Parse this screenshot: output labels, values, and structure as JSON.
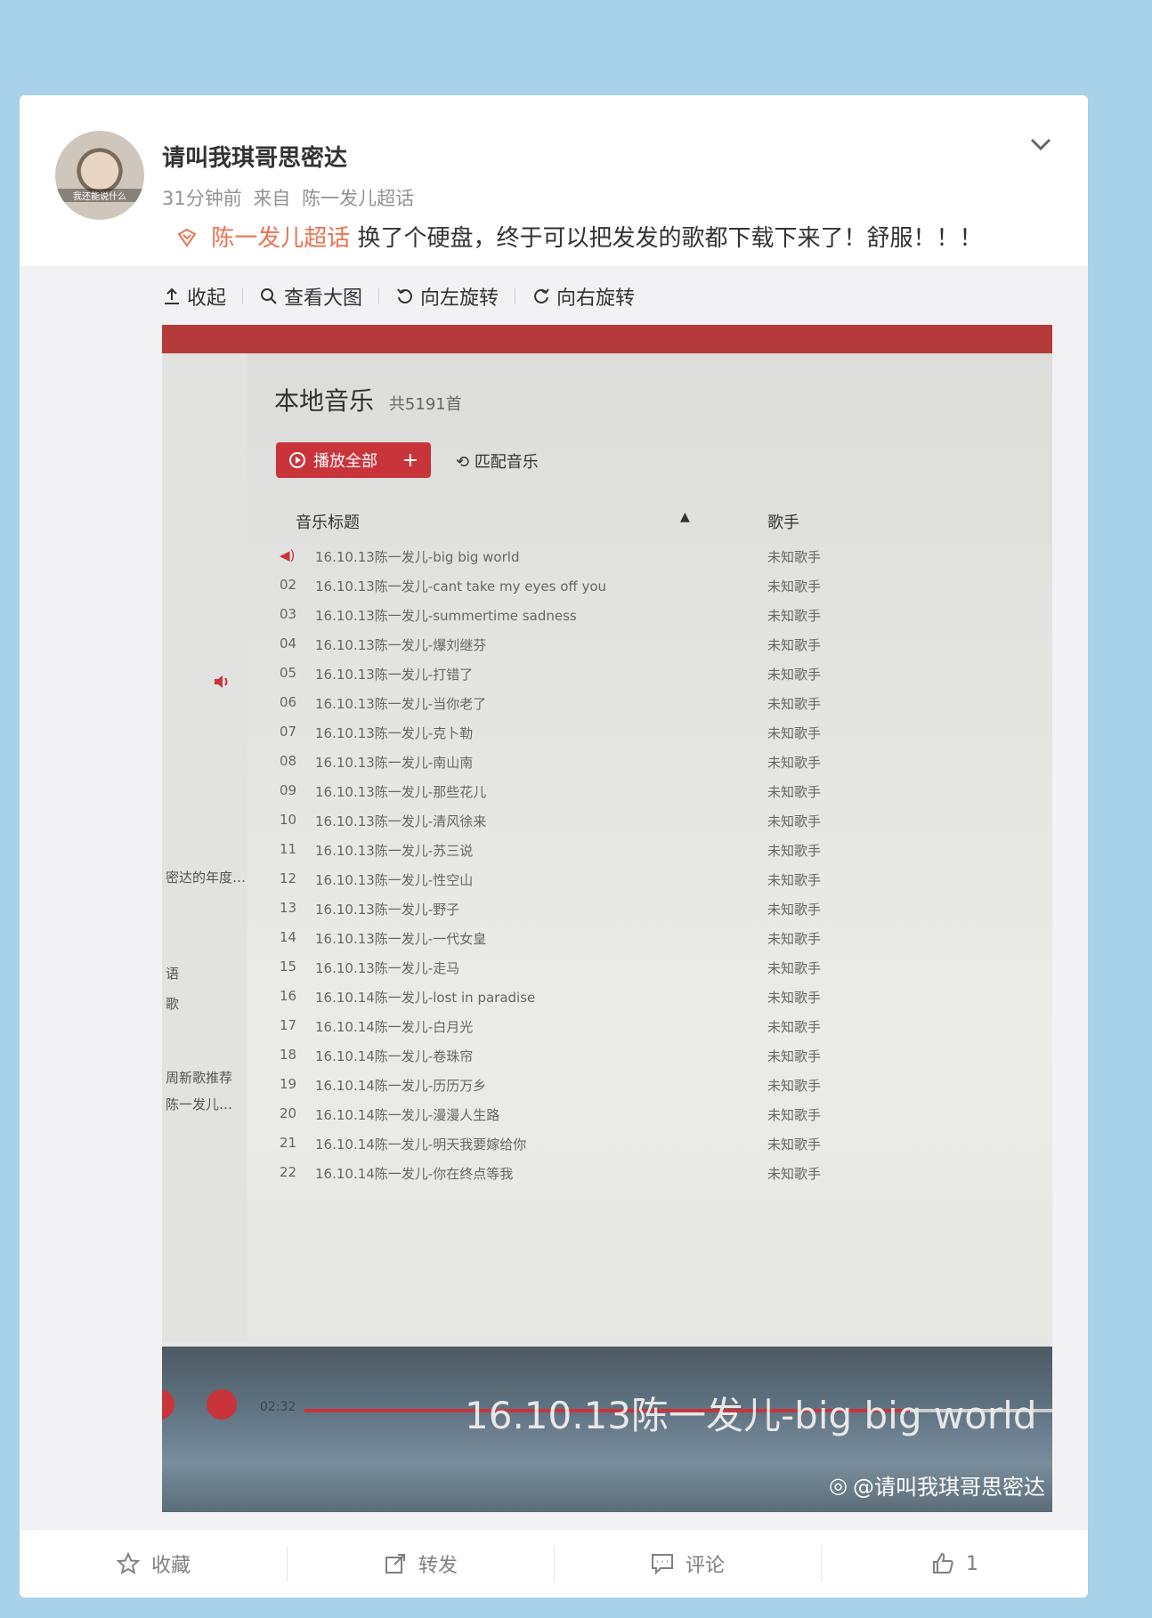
{
  "post": {
    "username": "请叫我琪哥思密达",
    "time": "31分钟前",
    "source_prefix": "来自",
    "source": "陈一发儿超话",
    "topic": "陈一发儿超话",
    "text": "换了个硬盘，终于可以把发发的歌都下载下来了！舒服！！！",
    "avatar_caption": "我还能说什么"
  },
  "toolbar": {
    "collapse": "收起",
    "view_large": "查看大图",
    "rotate_left": "向左旋转",
    "rotate_right": "向右旋转"
  },
  "photo": {
    "title": "本地音乐",
    "count": "共5191首",
    "play_all": "播放全部",
    "plus": "+",
    "match": "匹配音乐",
    "col_title": "音乐标题",
    "col_artist": "歌手",
    "rows": [
      {
        "num": "",
        "title": "16.10.13陈一发儿-big big world",
        "artist": "未知歌手"
      },
      {
        "num": "02",
        "title": "16.10.13陈一发儿-cant take my eyes off you",
        "artist": "未知歌手"
      },
      {
        "num": "03",
        "title": "16.10.13陈一发儿-summertime sadness",
        "artist": "未知歌手"
      },
      {
        "num": "04",
        "title": "16.10.13陈一发儿-爆刘继芬",
        "artist": "未知歌手"
      },
      {
        "num": "05",
        "title": "16.10.13陈一发儿-打错了",
        "artist": "未知歌手"
      },
      {
        "num": "06",
        "title": "16.10.13陈一发儿-当你老了",
        "artist": "未知歌手"
      },
      {
        "num": "07",
        "title": "16.10.13陈一发儿-克卜勒",
        "artist": "未知歌手"
      },
      {
        "num": "08",
        "title": "16.10.13陈一发儿-南山南",
        "artist": "未知歌手"
      },
      {
        "num": "09",
        "title": "16.10.13陈一发儿-那些花儿",
        "artist": "未知歌手"
      },
      {
        "num": "10",
        "title": "16.10.13陈一发儿-清风徐来",
        "artist": "未知歌手"
      },
      {
        "num": "11",
        "title": "16.10.13陈一发儿-苏三说",
        "artist": "未知歌手"
      },
      {
        "num": "12",
        "title": "16.10.13陈一发儿-性空山",
        "artist": "未知歌手"
      },
      {
        "num": "13",
        "title": "16.10.13陈一发儿-野子",
        "artist": "未知歌手"
      },
      {
        "num": "14",
        "title": "16.10.13陈一发儿-一代女皇",
        "artist": "未知歌手"
      },
      {
        "num": "15",
        "title": "16.10.13陈一发儿-走马",
        "artist": "未知歌手"
      },
      {
        "num": "16",
        "title": "16.10.14陈一发儿-lost in paradise",
        "artist": "未知歌手"
      },
      {
        "num": "17",
        "title": "16.10.14陈一发儿-白月光",
        "artist": "未知歌手"
      },
      {
        "num": "18",
        "title": "16.10.14陈一发儿-卷珠帘",
        "artist": "未知歌手"
      },
      {
        "num": "19",
        "title": "16.10.14陈一发儿-历历万乡",
        "artist": "未知歌手"
      },
      {
        "num": "20",
        "title": "16.10.14陈一发儿-漫漫人生路",
        "artist": "未知歌手"
      },
      {
        "num": "21",
        "title": "16.10.14陈一发儿-明天我要嫁给你",
        "artist": "未知歌手"
      },
      {
        "num": "22",
        "title": "16.10.14陈一发儿-你在终点等我",
        "artist": "未知歌手"
      }
    ],
    "sidebar_texts": [
      "密达的年度…",
      "语",
      "歌",
      "周新歌推荐",
      "陈一发儿…"
    ],
    "time": "02:32",
    "progress": 0.81,
    "caption": "16.10.13陈一发儿-big big world",
    "watermark": "@请叫我琪哥思密达"
  },
  "actions": {
    "favorite": "收藏",
    "repost": "转发",
    "comment": "评论",
    "like_count": "1"
  },
  "colors": {
    "background": "#a8d1ea",
    "topic": "#eb7350",
    "player_red": "#c8343a"
  }
}
